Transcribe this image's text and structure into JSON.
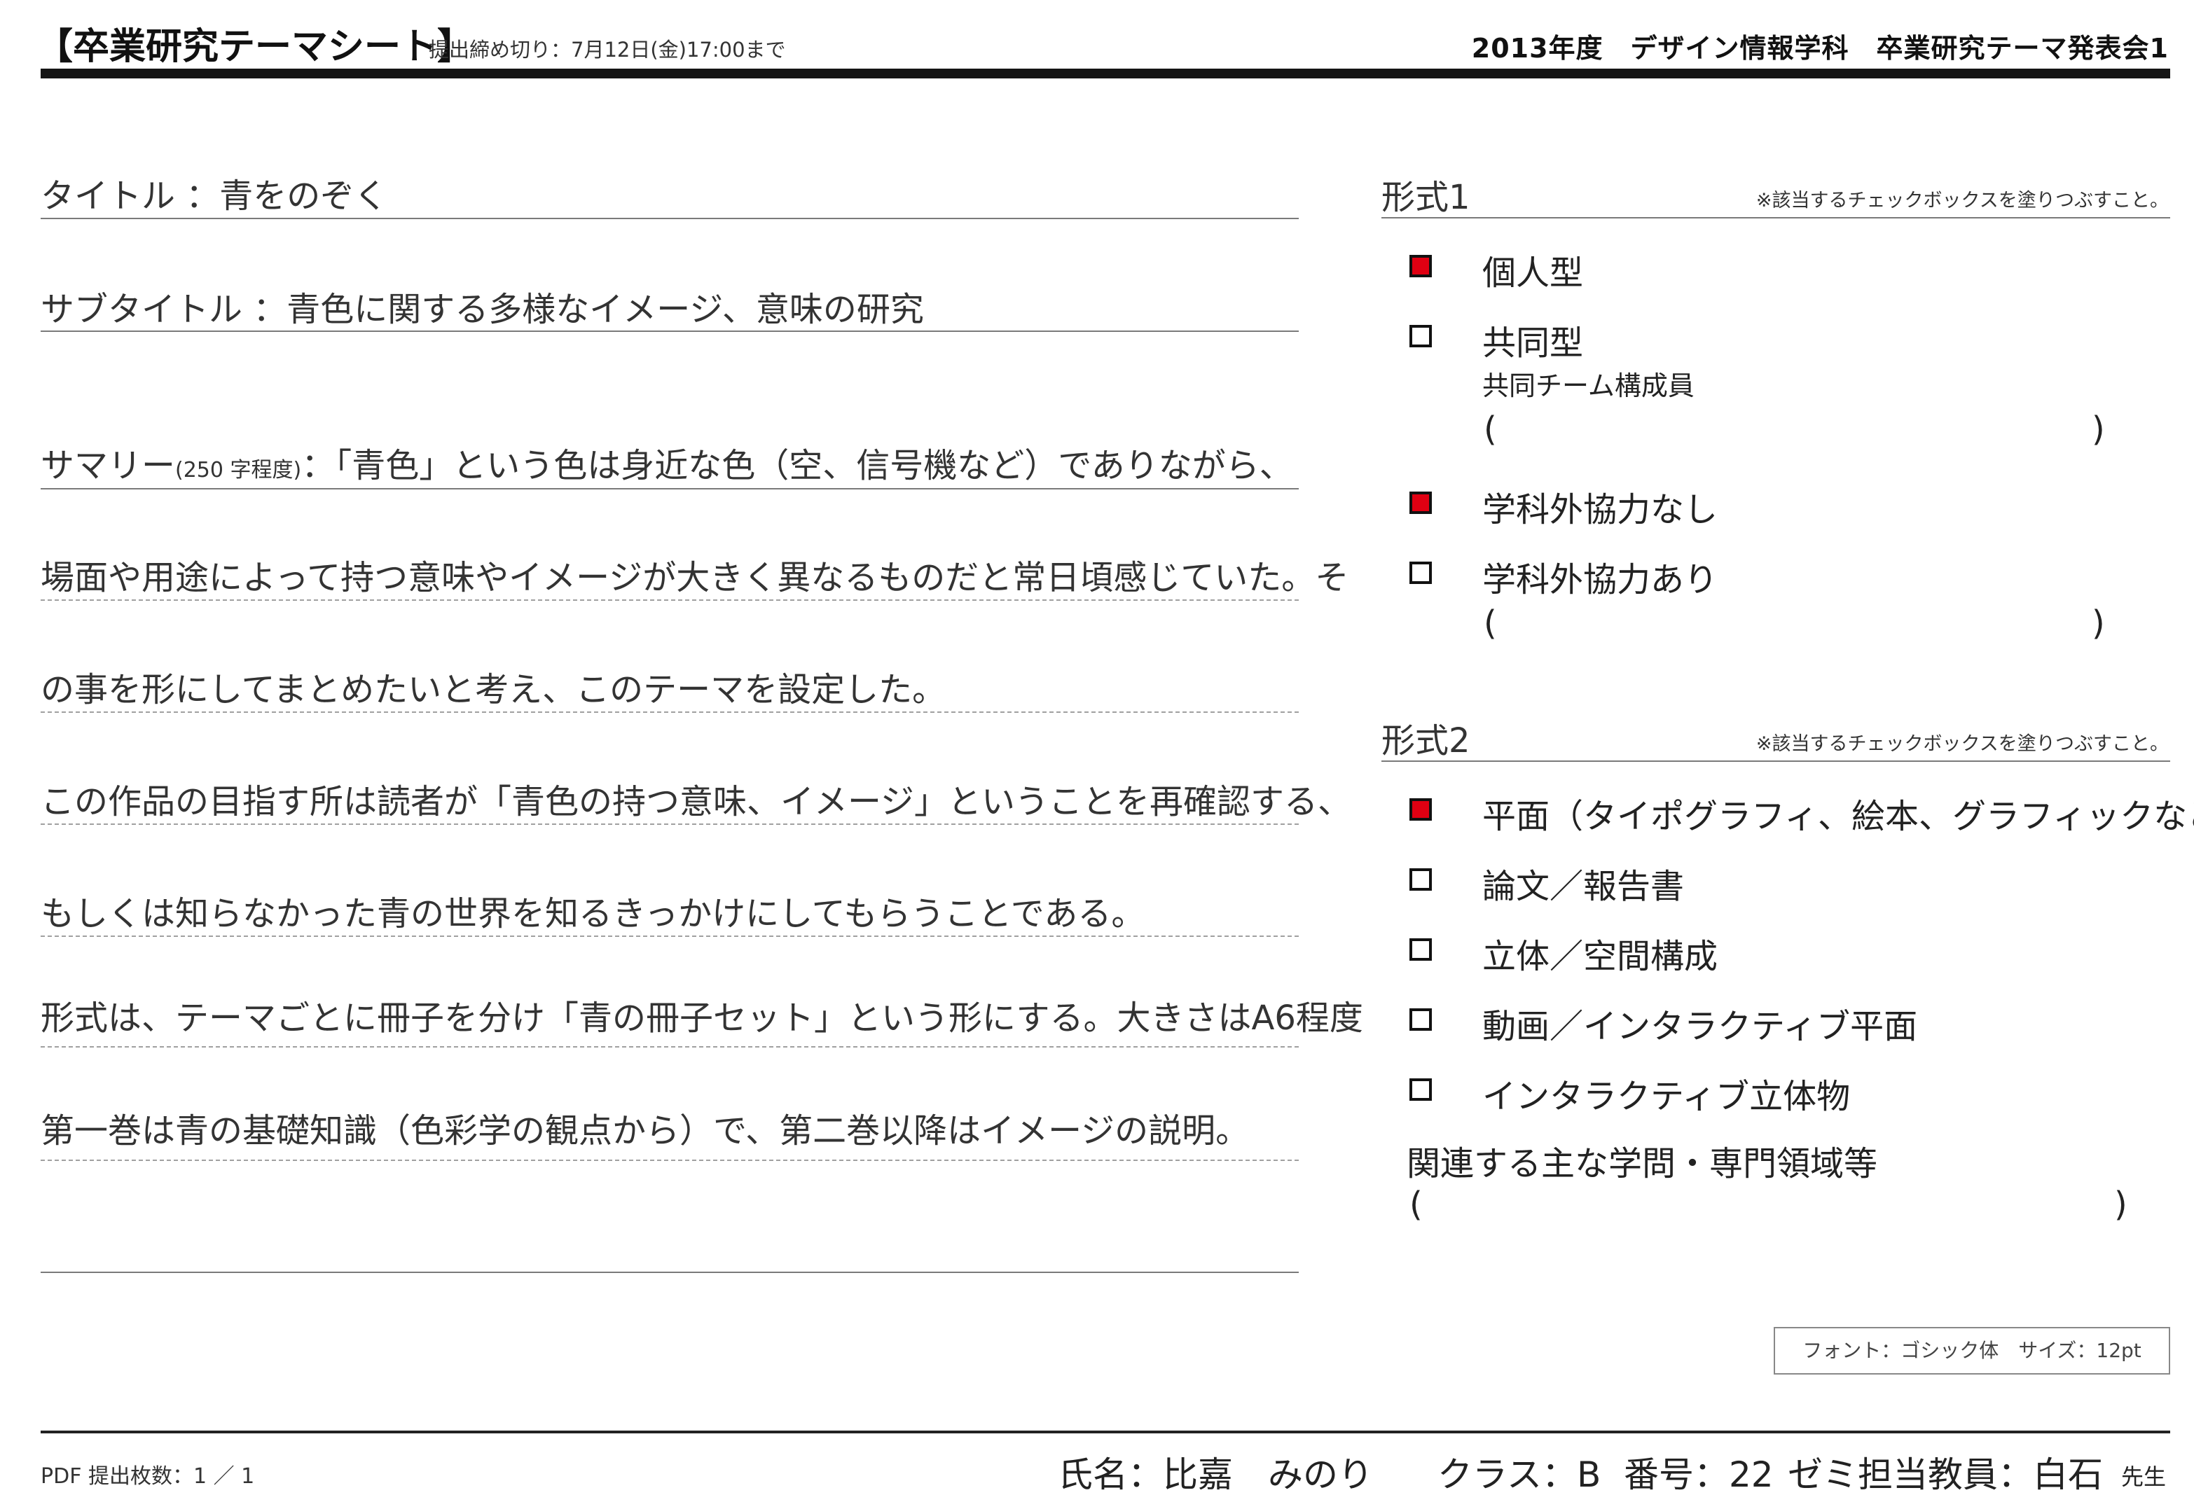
{
  "header": {
    "title": "【卒業研究テーマシート】",
    "deadline": "提出締め切り：7月12日(金)17:00まで",
    "right": "2013年度　デザイン情報学科　卒業研究テーマ発表会1"
  },
  "form": {
    "title_label": "タイトル",
    "title_value": "青をのぞく",
    "subtitle_label": "サブタイトル",
    "subtitle_value": "青色に関する多様なイメージ、意味の研究",
    "summary_label": "サマリー",
    "summary_note": "(250 字程度)",
    "summary_lines": [
      "：「青色」という色は身近な色（空、信号機など）でありながら、",
      "場面や用途によって持つ意味やイメージが大きく異なるものだと常日頃感じていた。そ",
      "の事を形にしてまとめたいと考え、このテーマを設定した。",
      "この作品の目指す所は読者が「青色の持つ意味、イメージ」ということを再確認する、",
      "もしくは知らなかった青の世界を知るきっかけにしてもらうことである。",
      "形式は、テーマごとに冊子を分け「青の冊子セット」という形にする。大きさはA6程度",
      "第一巻は青の基礎知識（色彩学の観点から）で、第二巻以降はイメージの説明。"
    ]
  },
  "format1": {
    "heading": "形式1",
    "note": "※該当するチェックボックスを塗りつぶすこと。",
    "options": [
      {
        "label": "個人型",
        "checked": true
      },
      {
        "label": "共同型",
        "checked": false,
        "sub": "共同チーム構成員"
      },
      {
        "label": "学科外協力なし",
        "checked": true
      },
      {
        "label": "学科外協力あり",
        "checked": false
      }
    ],
    "paren_open": "(",
    "paren_close": ")"
  },
  "format2": {
    "heading": "形式2",
    "note": "※該当するチェックボックスを塗りつぶすこと。",
    "options": [
      {
        "label": "平面（タイポグラフィ、絵本、グラフィックなど）",
        "checked": true
      },
      {
        "label": "論文／報告書",
        "checked": false
      },
      {
        "label": "立体／空間構成",
        "checked": false
      },
      {
        "label": "動画／インタラクティブ平面",
        "checked": false
      },
      {
        "label": "インタラクティブ立体物",
        "checked": false
      }
    ],
    "related_label": "関連する主な学問・専門領域等"
  },
  "font_box": "フォント：ゴシック体　サイズ：12pt",
  "footer": {
    "pdf_count": "PDF 提出枚数：1 ／ 1",
    "name": "氏名：比嘉　みのり",
    "class": "クラス：B",
    "number": "番号：22",
    "teacher": "ゼミ担当教員：白石",
    "sensei": "先生"
  },
  "colors": {
    "checked_fill": "#e00012",
    "rule": "#151515"
  }
}
